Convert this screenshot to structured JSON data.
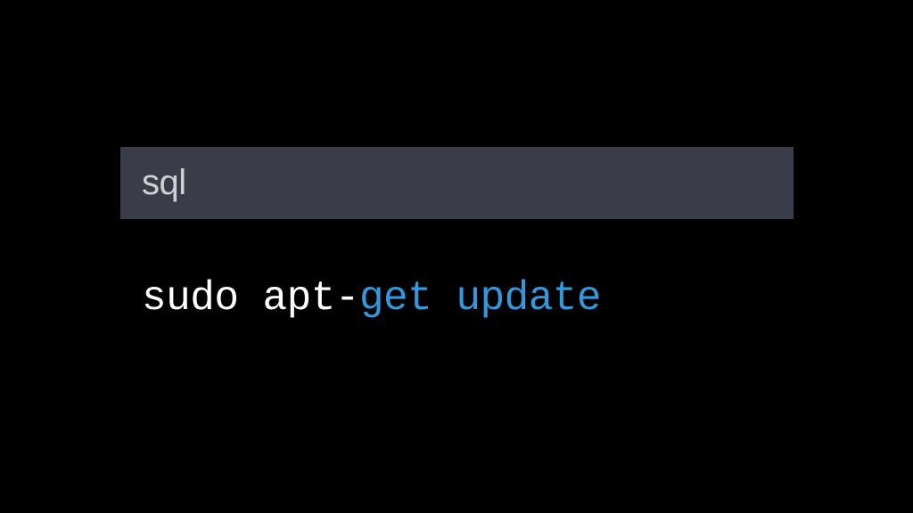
{
  "codeblock": {
    "language": "sql",
    "command": {
      "part1": "sudo apt-",
      "part2": "get",
      "part3": " ",
      "part4": "update"
    }
  },
  "colors": {
    "background": "#000000",
    "header_bg": "#3a3c4a",
    "header_text": "#d0d0d4",
    "plain_text": "#ffffff",
    "keyword": "#3399dd"
  }
}
